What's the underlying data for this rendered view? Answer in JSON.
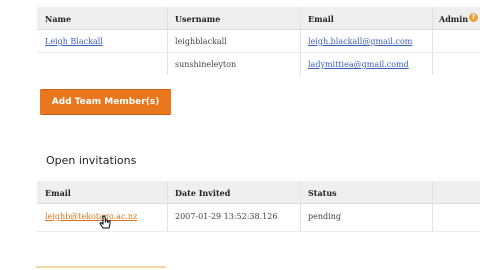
{
  "team": {
    "headers": {
      "name": "Name",
      "username": "Username",
      "email": "Email",
      "admin": "Admin"
    },
    "rows": [
      {
        "name": "Leigh Blackall",
        "username": "leighblackall",
        "email": "leigh.blackall@gmail.com"
      },
      {
        "name": "",
        "username": "sunshineleyton",
        "email": "ladymittiea@gmail.comd"
      }
    ]
  },
  "actions": {
    "add_team_member": "Add Team Member(s)"
  },
  "invitations": {
    "title": "Open invitations",
    "headers": {
      "email": "Email",
      "date_invited": "Date Invited",
      "status": "Status"
    },
    "rows": [
      {
        "email": "leighb@tekotago.ac.nz",
        "date_invited": "2007-01-29 13:52:38.126",
        "status": "pending"
      }
    ]
  },
  "colors": {
    "accent": "#e8771e",
    "link": "#3b5fb5",
    "header_bg": "#efefef"
  },
  "icons": {
    "admin_help": "question-icon",
    "cursor": "hand-pointer-icon"
  }
}
